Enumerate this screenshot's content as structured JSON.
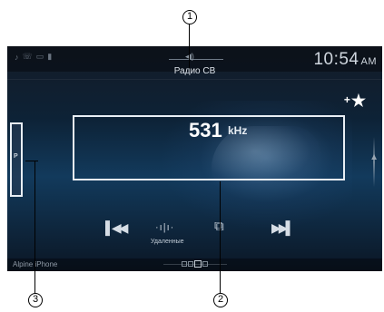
{
  "status": {
    "icons": [
      "audio-icon",
      "phone-icon",
      "battery-icon",
      "signal-icon"
    ],
    "volume_icon": "volume-icon",
    "time": "10:54",
    "ampm": "AM"
  },
  "source": {
    "label": "Радио СВ"
  },
  "favorite": {
    "plus": "+",
    "star": "★"
  },
  "tuner": {
    "frequency": "531",
    "unit": "kHz",
    "preset_tab": "P"
  },
  "controls": {
    "prev_symbol": "▌◀◀",
    "scan_symbol": "·ı|ı·",
    "scan_label": "Удаленные",
    "mode_symbol": "⧉",
    "next_symbol": "▶▶▌"
  },
  "bottom": {
    "label": "Alpine iPhone"
  },
  "callouts": {
    "c1": "1",
    "c2": "2",
    "c3": "3"
  }
}
